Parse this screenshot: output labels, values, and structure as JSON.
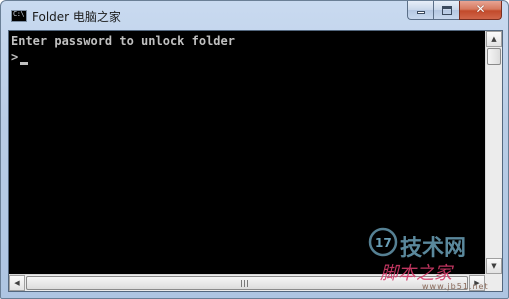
{
  "window": {
    "title": "Folder 电脑之家",
    "icon": "cmd-console-icon",
    "icon_text": "C:\\",
    "caption_buttons": {
      "minimize_icon": "minimize-icon",
      "maximize_icon": "maximize-icon",
      "close_glyph": "✕"
    }
  },
  "console": {
    "lines": [
      "Enter password to unlock folder",
      ">"
    ],
    "text_color": "#c0c0c0",
    "background_color": "#000000"
  },
  "scrollbars": {
    "up_arrow": "▲",
    "down_arrow": "▼",
    "left_arrow": "◀",
    "right_arrow": "▶"
  },
  "watermark": {
    "logo_number": "17",
    "main_text": "技术网",
    "sub_text": "脚本之家",
    "url_text": "www.jb51.net"
  },
  "colors": {
    "close_button": "#c24a2b",
    "title_bar": "#b9cde6",
    "watermark_blue": "#6aa0b8",
    "watermark_pink": "#d43b6a"
  }
}
